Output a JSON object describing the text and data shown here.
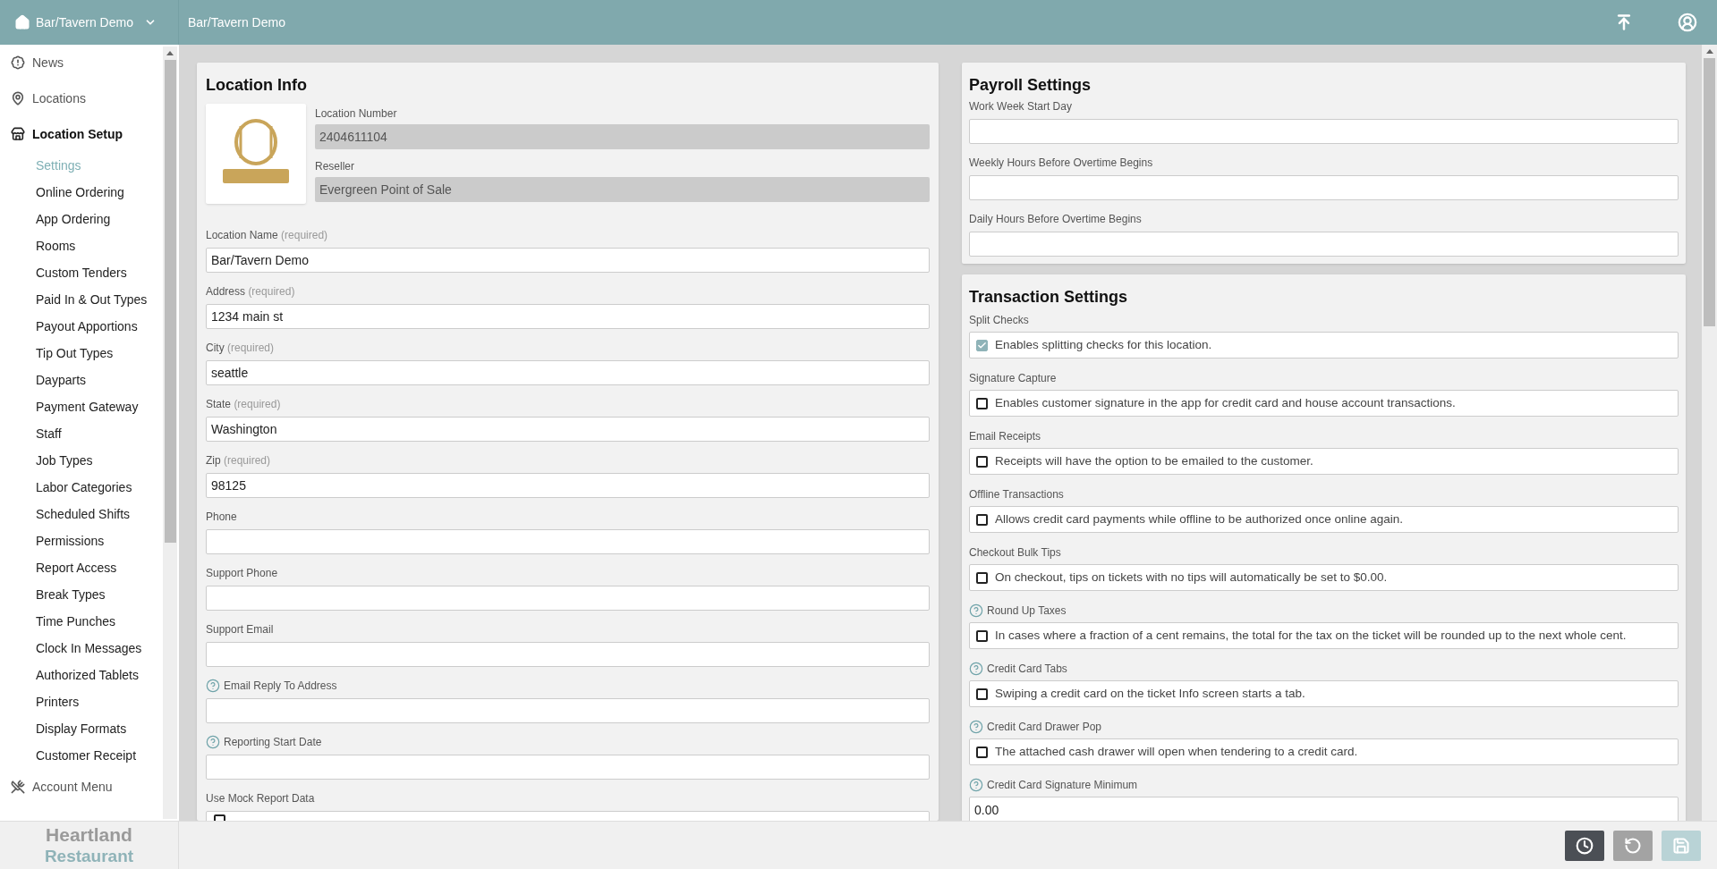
{
  "top_bar": {
    "location_switcher": "Bar/Tavern Demo",
    "breadcrumb": "Bar/Tavern Demo"
  },
  "sidebar": {
    "items": [
      {
        "label": "News",
        "selected": false
      },
      {
        "label": "Locations",
        "selected": false
      },
      {
        "label": "Location Setup",
        "selected": true,
        "children": [
          {
            "label": "Settings",
            "selected": true
          },
          {
            "label": "Online Ordering",
            "selected": false
          },
          {
            "label": "App Ordering",
            "selected": false
          },
          {
            "label": "Rooms",
            "selected": false
          },
          {
            "label": "Custom Tenders",
            "selected": false
          },
          {
            "label": "Paid In & Out Types",
            "selected": false
          },
          {
            "label": "Payout Apportions",
            "selected": false
          },
          {
            "label": "Tip Out Types",
            "selected": false
          },
          {
            "label": "Dayparts",
            "selected": false
          },
          {
            "label": "Payment Gateway",
            "selected": false
          },
          {
            "label": "Staff",
            "selected": false
          },
          {
            "label": "Job Types",
            "selected": false
          },
          {
            "label": "Labor Categories",
            "selected": false
          },
          {
            "label": "Scheduled Shifts",
            "selected": false
          },
          {
            "label": "Permissions",
            "selected": false
          },
          {
            "label": "Report Access",
            "selected": false
          },
          {
            "label": "Break Types",
            "selected": false
          },
          {
            "label": "Time Punches",
            "selected": false
          },
          {
            "label": "Clock In Messages",
            "selected": false
          },
          {
            "label": "Authorized Tablets",
            "selected": false
          },
          {
            "label": "Printers",
            "selected": false
          },
          {
            "label": "Display Formats",
            "selected": false
          },
          {
            "label": "Customer Receipt",
            "selected": false
          }
        ]
      },
      {
        "label": "Account Menu",
        "selected": false
      }
    ],
    "brand": {
      "line_1": "Heartland",
      "line_2": "Restaurant"
    }
  },
  "location_info": {
    "title": "Location Info",
    "readonly_fields": [
      {
        "label": "Location Number",
        "value": "2404611104",
        "disabled": true
      },
      {
        "label": "Reseller",
        "value": "Evergreen Point of Sale",
        "disabled": true
      }
    ],
    "fields": [
      {
        "label": "Location Name",
        "note": "(required)",
        "help": false,
        "kind": "text",
        "value": "Bar/Tavern Demo"
      },
      {
        "label": "Address",
        "note": "(required)",
        "help": false,
        "kind": "text",
        "value": "1234 main st"
      },
      {
        "label": "City",
        "note": "(required)",
        "help": false,
        "kind": "text",
        "value": "seattle"
      },
      {
        "label": "State",
        "note": "(required)",
        "help": false,
        "kind": "text",
        "value": "Washington"
      },
      {
        "label": "Zip",
        "note": "(required)",
        "help": false,
        "kind": "text",
        "value": "98125"
      },
      {
        "label": "Phone",
        "help": false,
        "kind": "text"
      },
      {
        "label": "Support Phone",
        "help": false,
        "kind": "text"
      },
      {
        "label": "Support Email",
        "help": false,
        "kind": "text"
      },
      {
        "label": "Email Reply To Address",
        "help": true,
        "kind": "text"
      },
      {
        "label": "Reporting Start Date",
        "help": true,
        "kind": "text"
      },
      {
        "label": "Use Mock Report Data",
        "help": false,
        "kind": "checkbox",
        "checked": false
      }
    ]
  },
  "payroll_settings": {
    "title": "Payroll Settings",
    "fields": [
      {
        "label": "Work Week Start Day"
      },
      {
        "label": "Weekly Hours Before Overtime Begins"
      },
      {
        "label": "Daily Hours Before Overtime Begins"
      }
    ]
  },
  "transaction_settings": {
    "title": "Transaction Settings",
    "fields": [
      {
        "label": "Split Checks",
        "help": false,
        "kind": "checkbox",
        "checked": true,
        "text": "Enables splitting checks for this location."
      },
      {
        "label": "Signature Capture",
        "help": false,
        "kind": "checkbox",
        "checked": false,
        "text": "Enables customer signature in the app for credit card and house account transactions."
      },
      {
        "label": "Email Receipts",
        "help": false,
        "kind": "checkbox",
        "checked": false,
        "text": "Receipts will have the option to be emailed to the customer."
      },
      {
        "label": "Offline Transactions",
        "help": false,
        "kind": "checkbox",
        "checked": false,
        "text": "Allows credit card payments while offline to be authorized once online again."
      },
      {
        "label": "Checkout Bulk Tips",
        "help": false,
        "kind": "checkbox",
        "checked": false,
        "text": "On checkout, tips on tickets with no tips will automatically be set to $0.00."
      },
      {
        "label": "Round Up Taxes",
        "help": true,
        "kind": "checkbox",
        "checked": false,
        "text": "In cases where a fraction of a cent remains, the total for the tax on the ticket will be rounded up to the next whole cent."
      },
      {
        "label": "Credit Card Tabs",
        "help": true,
        "kind": "checkbox",
        "checked": false,
        "text": "Swiping a credit card on the ticket Info screen starts a tab."
      },
      {
        "label": "Credit Card Drawer Pop",
        "help": true,
        "kind": "checkbox",
        "checked": false,
        "text": "The attached cash drawer will open when tendering to a credit card."
      },
      {
        "label": "Credit Card Signature Minimum",
        "help": true,
        "kind": "text",
        "value": "0.00"
      }
    ]
  },
  "action_buttons": [
    {
      "kind": "history",
      "disabled": false
    },
    {
      "kind": "undo",
      "disabled": true
    },
    {
      "kind": "save",
      "disabled": true
    }
  ]
}
